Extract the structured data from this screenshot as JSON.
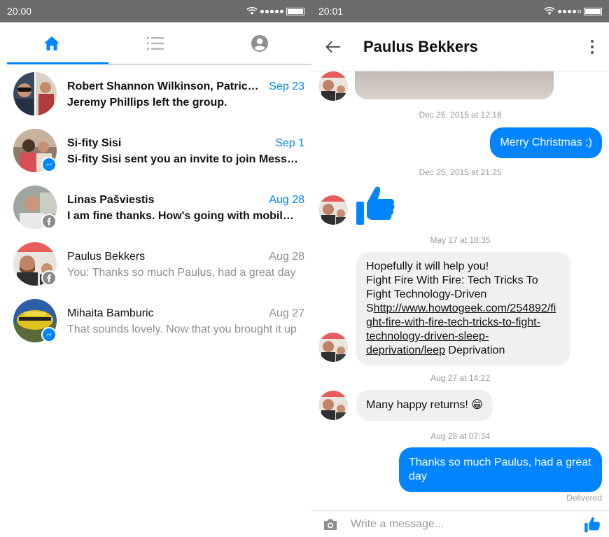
{
  "left": {
    "status": {
      "time": "20:00"
    },
    "tabs": [
      {
        "icon": "home-icon"
      },
      {
        "icon": "list-icon"
      },
      {
        "icon": "profile-icon"
      }
    ],
    "conversations": [
      {
        "name": "Robert Shannon Wilkinson, Patrick Dowling",
        "date": "Sep 23",
        "snippet": "Jeremy Phillips left the group.",
        "unread": true,
        "badge": ""
      },
      {
        "name": "Si-fity Sisi",
        "date": "Sep 1",
        "snippet": "Si-fity Sisi sent you an invite to join Messenger",
        "unread": true,
        "badge": "messenger-badge-icon"
      },
      {
        "name": "Linas Pašviestis",
        "date": "Aug 28",
        "snippet": "I am fine thanks. How's going with mobile apps?",
        "unread": true,
        "badge": "facebook-badge-icon"
      },
      {
        "name": "Paulus Bekkers",
        "date": "Aug 28",
        "snippet": "You: Thanks so much Paulus, had a great day",
        "unread": false,
        "badge": "facebook-badge-icon"
      },
      {
        "name": "Mihaita Bamburic",
        "date": "Aug 27",
        "snippet": "That sounds lovely. Now that you brought it up",
        "unread": false,
        "badge": "messenger-badge-icon"
      }
    ]
  },
  "right": {
    "status": {
      "time": "20:01"
    },
    "header": {
      "title": "Paulus Bekkers"
    },
    "messages": {
      "stamp1": "Dec 25, 2015 at 12:18",
      "out1": "Merry Christmas ;)",
      "stamp2": "Dec 25, 2015 at 21:25",
      "stamp3": "May 17 at 18:35",
      "in_text_a": "Hopefully it will help you!",
      "in_text_b": "Fight Fire With Fire: Tech Tricks To Fight Technology-Driven S",
      "in_link": "http://www.howtogeek.com/254892/fight-fire-with-fire-tech-tricks-to-fight-technology-driven-sleep-deprivation/leep",
      "in_text_c": " Deprivation",
      "stamp4": "Aug 27 at 14:22",
      "in2": "Many happy returns! 😁",
      "stamp5": "Aug 28 at 07:34",
      "out2": "Thanks so much Paulus, had a great day",
      "delivered": "Delivered"
    },
    "composer": {
      "placeholder": "Write a message..."
    }
  },
  "colors": {
    "accent": "#0084ff",
    "status_bar": "#6b6b6b",
    "incoming_bubble": "#f1f0f0"
  }
}
